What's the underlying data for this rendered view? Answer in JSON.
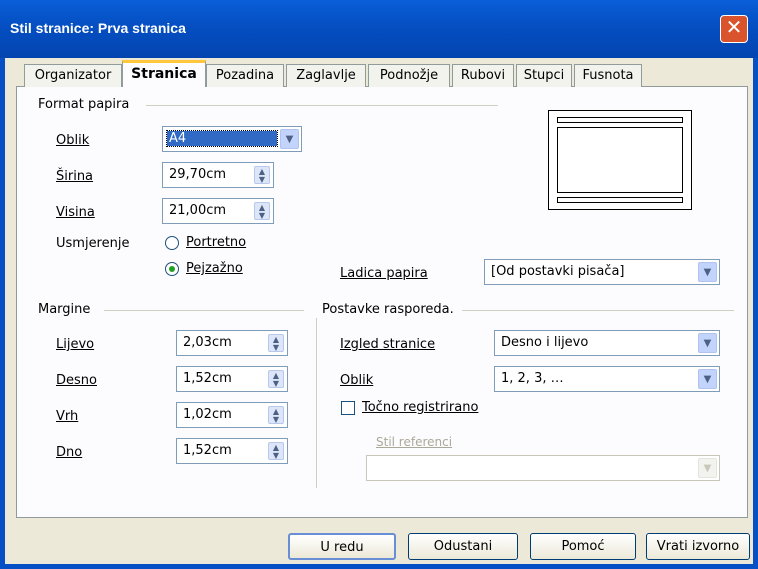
{
  "window": {
    "title": "Stil stranice: Prva stranica",
    "close_glyph": "✕"
  },
  "tabs": [
    {
      "label": "Organizator"
    },
    {
      "label": "Stranica",
      "active": true
    },
    {
      "label": "Pozadina"
    },
    {
      "label": "Zaglavlje"
    },
    {
      "label": "Podnožje"
    },
    {
      "label": "Rubovi"
    },
    {
      "label": "Stupci"
    },
    {
      "label": "Fusnota"
    }
  ],
  "paper_format": {
    "section": "Format papira",
    "format_label": "Oblik",
    "format_value": "A4",
    "width_label": "Širina",
    "width_value": "29,70cm",
    "height_label": "Visina",
    "height_value": "21,00cm",
    "orientation_label": "Usmjerenje",
    "portrait_label": "Portretno",
    "landscape_label": "Pejzažno",
    "orientation_selected": "landscape",
    "paper_tray_label": "Ladica papira",
    "paper_tray_value": "[Od postavki pisača]"
  },
  "margins": {
    "section": "Margine",
    "left_label": "Lijevo",
    "left_value": "2,03cm",
    "right_label": "Desno",
    "right_value": "1,52cm",
    "top_label": "Vrh",
    "top_value": "1,02cm",
    "bottom_label": "Dno",
    "bottom_value": "1,52cm"
  },
  "layout": {
    "section": "Postavke rasporeda.",
    "page_layout_label": "Izgled stranice",
    "page_layout_value": "Desno i lijevo",
    "format_label": "Oblik",
    "format_value": "1, 2, 3, …",
    "register_true_label": "Točno registrirano",
    "register_true_checked": false,
    "reference_style_label": "Stil referenci",
    "reference_style_value": ""
  },
  "buttons": {
    "ok": "U redu",
    "cancel": "Odustani",
    "help": "Pomoć",
    "reset": "Vrati izvorno"
  },
  "colors": {
    "title_bar": "#0550c4",
    "dialog_bg": "#ece9d8",
    "close_button": "#d9532c",
    "tab_highlight": "#ffc83c"
  }
}
